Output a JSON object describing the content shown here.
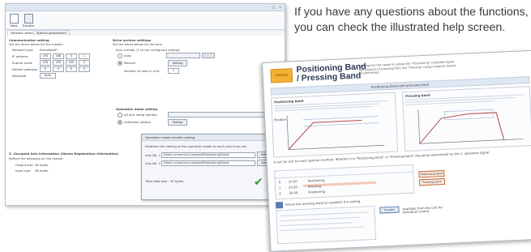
{
  "caption": "If you have any questions about the functions, you can check the illustrated help screen.",
  "window": {
    "ribbon": [
      {
        "label": "Save"
      },
      {
        "label": "Transfer"
      }
    ],
    "tabs": [
      "Network setting",
      "Special parameters"
    ],
    "left": {
      "section1": "Communication setting",
      "section1_desc": "Set the items below for the master.",
      "network_type_label": "Network type",
      "network_type_value": "EtherNet/IP",
      "ip_label": "IP address",
      "ip_values": [
        "192",
        "168",
        "0",
        "1"
      ],
      "subnet_label": "Subnet mask",
      "subnet_values": [
        "255",
        "255",
        "255",
        "0"
      ],
      "gateway_label": "Default gateway",
      "gateway_values": [
        "0",
        "0",
        "0",
        "0"
      ],
      "baud_label": "Baudrate",
      "baud_value": "Auto",
      "section2": "Z. Occupied Axis Information (Slaves Registration Information)",
      "section2_desc": "Reflect the following on the master.",
      "output_label": "Output size",
      "output_value": "96 bytes",
      "input_label": "Input size",
      "input_value": "96 bytes"
    },
    "right": {
      "section": "Drive archive settings",
      "desc": "Set the items below for the axis.",
      "axis_label": "Axis number (1 to the configured setting)",
      "opt_auto": "Auto",
      "opt_manual": "Manual",
      "setting_btn": "Setting",
      "axes_label": "Number of axes in unit",
      "axes_value": "1",
      "op_mode": "Operation mode setting",
      "opt_all": "All axis setup identity",
      "opt_individual": "Individual setting",
      "setting_btn2": "Setting"
    },
    "popup": {
      "title": "Operation mode transfer setting",
      "desc": "Establish the setting of the operation mode to each axis to be set.",
      "rows": [
        {
          "label": "Axis No. 1",
          "value": "Direct numerical (compact)Positioning/Direct",
          "btn": "Set"
        },
        {
          "label": "Axis No. 2",
          "value": "Direct numerical (compact)Positioning/Direct",
          "btn": "Set"
        }
      ],
      "total": "Total data size : 32 bytes"
    }
  },
  "help": {
    "logo": "CONTROL",
    "title_line1": "Positioning Band",
    "title_line2": "/ Pressing Band",
    "subtitle": "Settings for the range to output the \"Positioning\" complete signal and amount of pressing from the \"Pressing\" range (relative should be performed.",
    "band": "Positioning band and pressing band",
    "left_panel_title": "Positioning band",
    "right_panel_title": "Pressing band",
    "axis_label": "Position",
    "table_note": "A set (as set) for each position number. Whether it is \"Positioning band\" or \"Pressing band\" should be determined by the 1. operation signal.",
    "rows": [
      {
        "no": "0",
        "pos": "10.00",
        "note": "Positioning"
      },
      {
        "no": "1",
        "pos": "20.00",
        "note": "Pressing"
      },
      {
        "no": "2",
        "pos": "30.00",
        "note": "Positioning"
      }
    ],
    "btn_positioning": "Positioning band",
    "btn_pressing": "Pressing band",
    "bottom_note": "Follow the pressing band to establish the setting.",
    "bottom_btn": "Transfer",
    "bottom_label": "Available from the unit for individual control.",
    "colors": {
      "accent": "#f2b233",
      "title": "#2b3a55",
      "curve": "#b04a4a"
    }
  }
}
